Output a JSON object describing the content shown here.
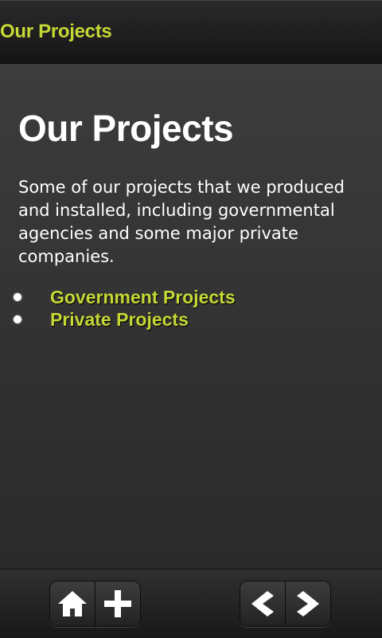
{
  "header": {
    "title": "Our Projects"
  },
  "main": {
    "heading": "Our Projects",
    "intro": "Some of our projects that we produced and installed, including governmental agencies and some major private companies.",
    "links": [
      {
        "label": "Government Projects"
      },
      {
        "label": "Private Projects"
      }
    ]
  },
  "toolbar": {
    "left_icons": [
      "home-icon",
      "plus-icon"
    ],
    "right_icons": [
      "back-arrow-icon",
      "forward-arrow-icon"
    ]
  },
  "colors": {
    "accent": "#c5d834",
    "background": "#2f2f2f",
    "text": "#ffffff"
  }
}
